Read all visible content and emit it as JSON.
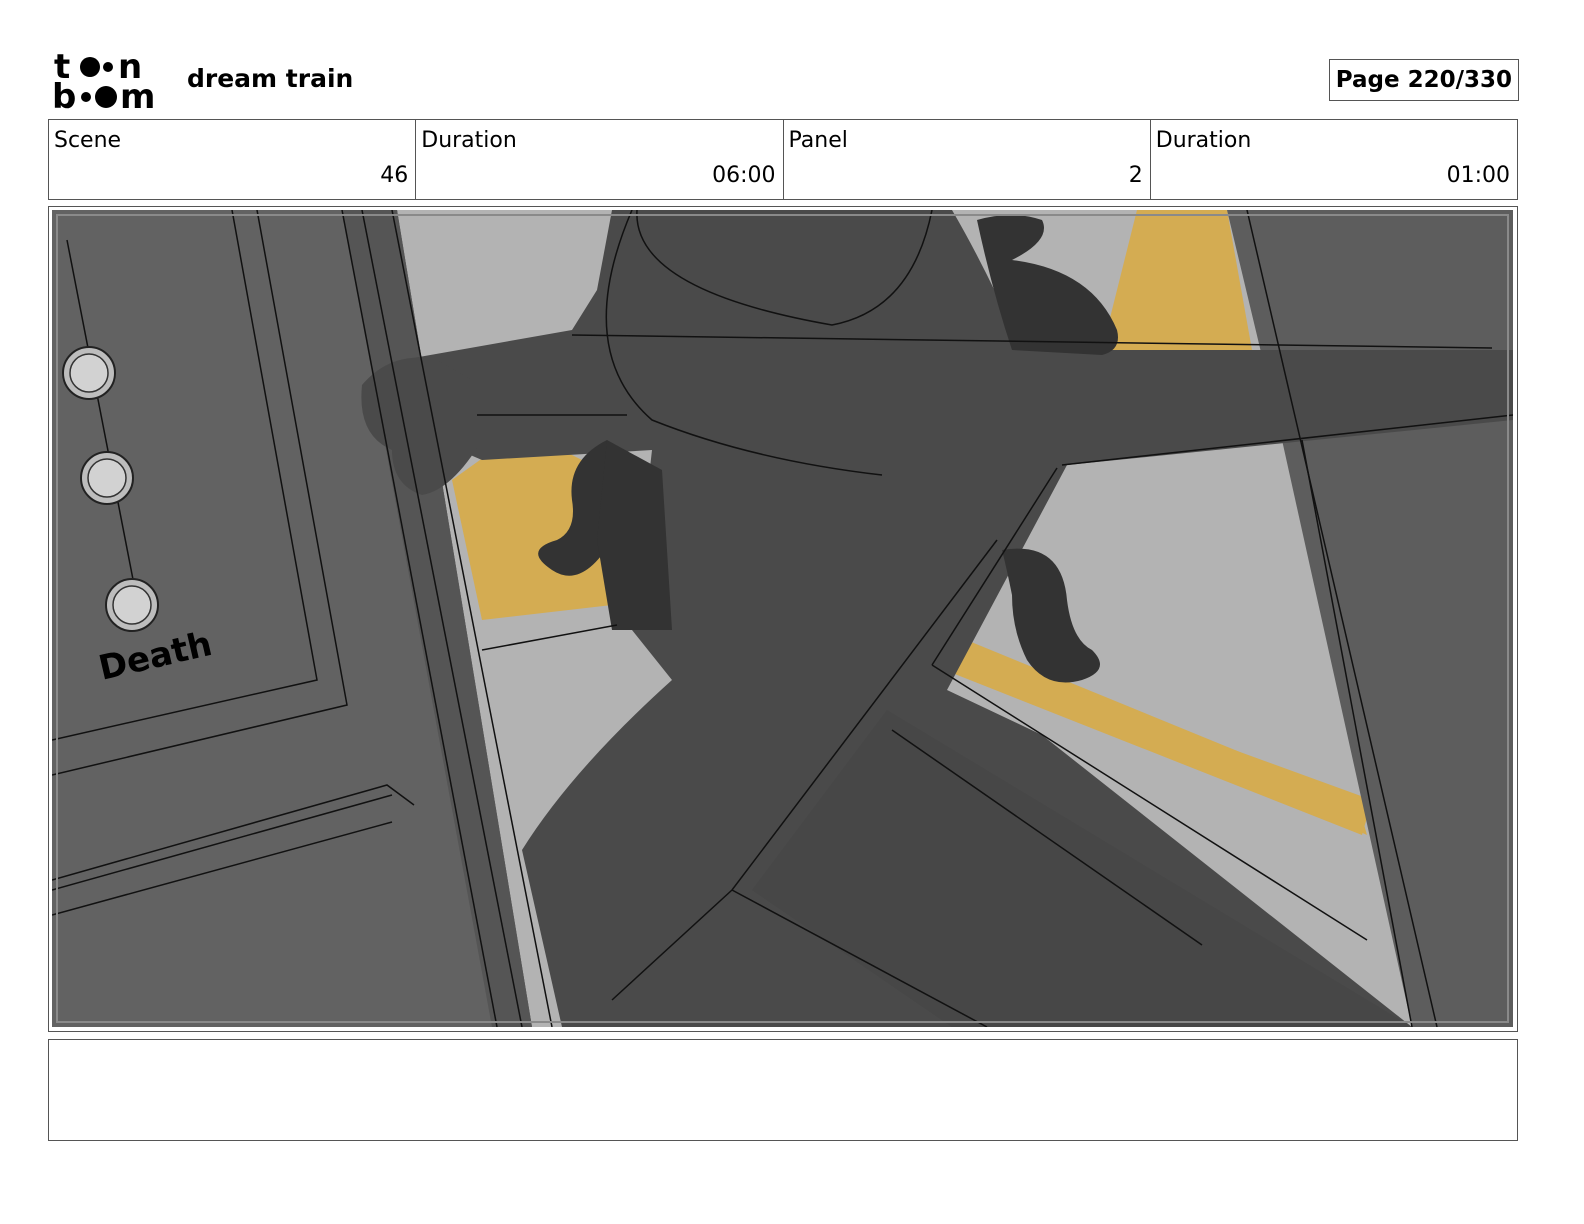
{
  "header": {
    "logo": {
      "name": "toon-boom-logo",
      "line1": "toon",
      "line2": "boom"
    },
    "project_title": "dream train",
    "page_label": "Page 220/330"
  },
  "info_table": {
    "scene_label": "Scene",
    "scene_value": "46",
    "scene_duration_label": "Duration",
    "scene_duration_value": "06:00",
    "panel_label": "Panel",
    "panel_value": "2",
    "panel_duration_label": "Duration",
    "panel_duration_value": "01:00"
  },
  "panel": {
    "door_sign": "Death",
    "colors": {
      "dark_gray": "#4a4a4a",
      "mid_gray": "#666666",
      "light_gray": "#b3b3b3",
      "yellow": "#d4ac52",
      "black_fill": "#333333"
    }
  },
  "notes": {
    "text": ""
  }
}
